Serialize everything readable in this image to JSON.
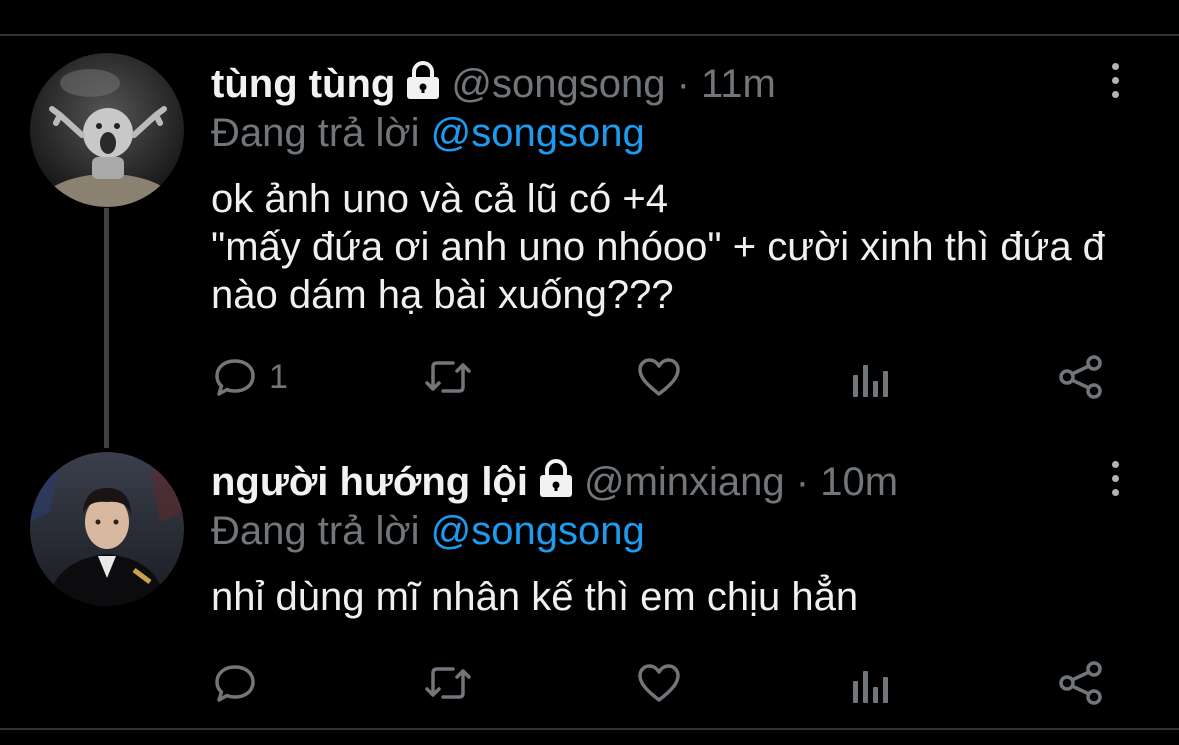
{
  "tweets": [
    {
      "display_name": "tùng tùng",
      "handle": "@songsong",
      "separator": "·",
      "time": "11m",
      "replying_prefix": "Đang trả lời",
      "replying_to": "@songsong",
      "text": "ok ảnh uno và cả lũ có +4\n\"mấy đứa ơi anh uno nhóoo\" + cười xinh thì đứa đ\nnào dám hạ bài xuống???",
      "reply_count": "1"
    },
    {
      "display_name": "người hướng lội",
      "handle": "@minxiang",
      "separator": "·",
      "time": "10m",
      "replying_prefix": "Đang trả lời",
      "replying_to": "@songsong",
      "text": "nhỉ dùng mĩ nhân kế thì em chịu hẳn",
      "reply_count": ""
    }
  ],
  "icons": [
    "lock-icon",
    "more-options-icon",
    "reply-icon",
    "retweet-icon",
    "like-icon",
    "analytics-icon",
    "share-icon"
  ],
  "colors": {
    "background": "#000000",
    "text": "#e7e9ea",
    "secondary": "#71767b",
    "accent": "#1d9bf0",
    "divider": "#2f3336"
  }
}
